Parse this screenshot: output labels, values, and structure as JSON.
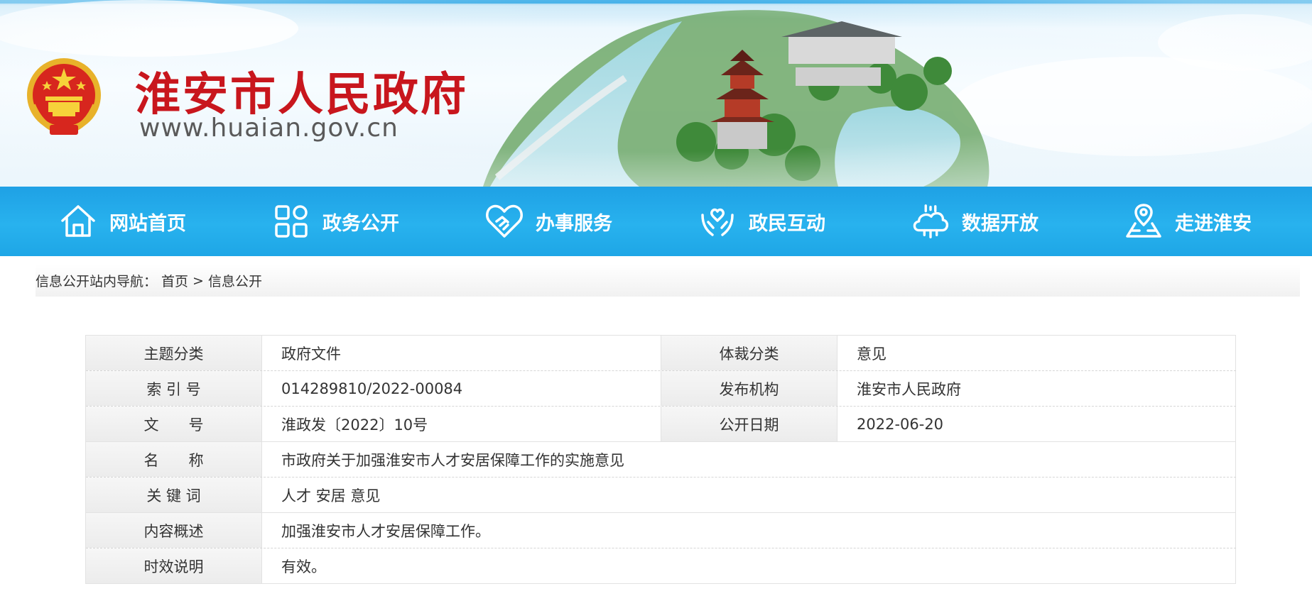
{
  "header": {
    "site_title": "淮安市人民政府",
    "site_url": "www.huaian.gov.cn",
    "emblem_icon": "national-emblem-icon",
    "title_color": "#c8161d"
  },
  "nav": {
    "items": [
      {
        "label": "网站首页",
        "icon": "home-icon"
      },
      {
        "label": "政务公开",
        "icon": "grid-icon"
      },
      {
        "label": "办事服务",
        "icon": "handshake-heart-icon"
      },
      {
        "label": "政民互动",
        "icon": "hands-heart-icon"
      },
      {
        "label": "数据开放",
        "icon": "data-cloud-icon"
      },
      {
        "label": "走进淮安",
        "icon": "location-map-icon"
      }
    ],
    "background": "#1fa8e8"
  },
  "breadcrumb": {
    "label": "信息公开站内导航：",
    "home": "首页",
    "separator": ">",
    "current": "信息公开"
  },
  "info": {
    "theme_label": "主题分类",
    "theme_value": "政府文件",
    "genre_label": "体裁分类",
    "genre_value": "意见",
    "index_label": "索 引 号",
    "index_value": "014289810/2022-00084",
    "publisher_label": "发布机构",
    "publisher_value": "淮安市人民政府",
    "doc_no_label": "文　　号",
    "doc_no_value": "淮政发〔2022〕10号",
    "date_label": "公开日期",
    "date_value": "2022-06-20",
    "name_label": "名　　称",
    "name_value": "市政府关于加强淮安市人才安居保障工作的实施意见",
    "keywords_label": "关 键 词",
    "keywords_value": "人才 安居 意见",
    "summary_label": "内容概述",
    "summary_value": "加强淮安市人才安居保障工作。",
    "validity_label": "时效说明",
    "validity_value": "有效。"
  }
}
